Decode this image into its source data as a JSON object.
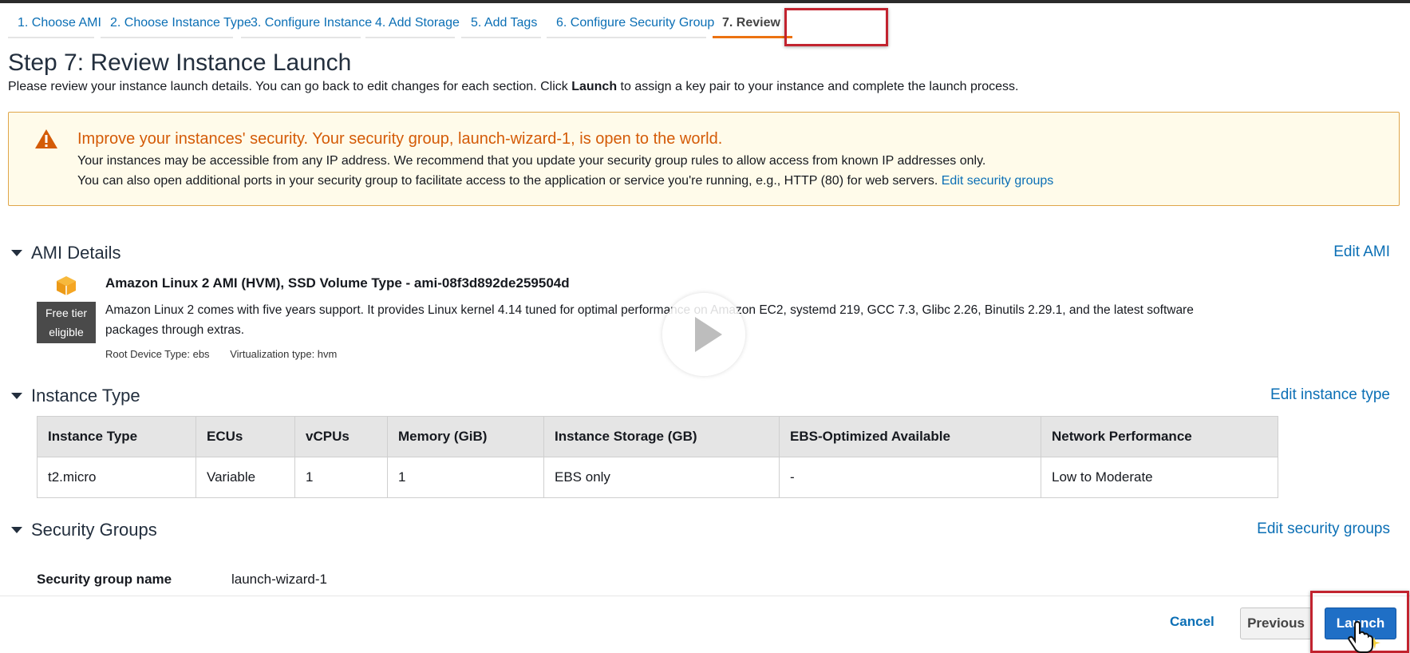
{
  "wizard_tabs": [
    {
      "label": "1. Choose AMI"
    },
    {
      "label": "2. Choose Instance Type"
    },
    {
      "label": "3. Configure Instance"
    },
    {
      "label": "4. Add Storage"
    },
    {
      "label": "5. Add Tags"
    },
    {
      "label": "6. Configure Security Group"
    },
    {
      "label": "7. Review",
      "active": true
    }
  ],
  "page": {
    "title": "Step 7: Review Instance Launch",
    "intro_before": "Please review your instance launch details. You can go back to edit changes for each section. Click ",
    "intro_bold": "Launch",
    "intro_after": " to assign a key pair to your instance and complete the launch process."
  },
  "warning": {
    "title": "Improve your instances' security. Your security group, launch-wizard-1, is open to the world.",
    "line1": "Your instances may be accessible from any IP address. We recommend that you update your security group rules to allow access from known IP addresses only.",
    "line2": "You can also open additional ports in your security group to facilitate access to the application or service you're running, e.g., HTTP (80) for web servers.",
    "link": "Edit security groups",
    "color": "#d45b07"
  },
  "ami_section": {
    "title": "AMI Details",
    "edit_link": "Edit AMI",
    "ami_name": "Amazon Linux 2 AMI (HVM), SSD Volume Type - ami-08f3d892de259504d",
    "badge_line1": "Free tier",
    "badge_line2": "eligible",
    "description": "Amazon Linux 2 comes with five years support. It provides Linux kernel 4.14 tuned for optimal performance on Amazon EC2, systemd 219, GCC 7.3, Glibc 2.26, Binutils 2.29.1, and the latest software packages through extras.",
    "root_device": "Root Device Type: ebs",
    "virtualization": "Virtualization type: hvm"
  },
  "instance_section": {
    "title": "Instance Type",
    "edit_link": "Edit instance type",
    "headers": [
      "Instance Type",
      "ECUs",
      "vCPUs",
      "Memory (GiB)",
      "Instance Storage (GB)",
      "EBS-Optimized Available",
      "Network Performance"
    ],
    "row": [
      "t2.micro",
      "Variable",
      "1",
      "1",
      "EBS only",
      "-",
      "Low to Moderate"
    ]
  },
  "security_section": {
    "title": "Security Groups",
    "edit_link": "Edit security groups",
    "name_label": "Security group name",
    "name_value": "launch-wizard-1"
  },
  "footer": {
    "cancel": "Cancel",
    "previous": "Previous",
    "launch": "Launch"
  },
  "colors": {
    "link": "#0b6fb5",
    "primary_button": "#1f6fc6",
    "highlight_box": "#c2232f",
    "active_tab_underline": "#ec7211"
  }
}
